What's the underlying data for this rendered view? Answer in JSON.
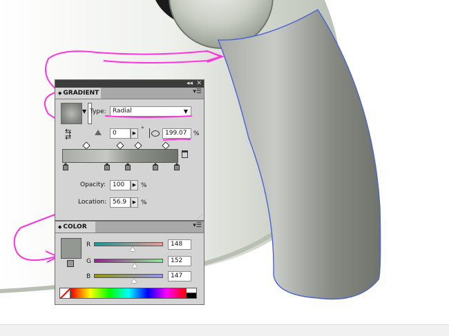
{
  "gradient_panel": {
    "tab_label": "GRADIENT",
    "type_label": "Type:",
    "type_value": "Radial",
    "angle_value": "0",
    "degree_symbol": "°",
    "aspect_value": "199.07",
    "aspect_unit": "%",
    "opacity_label": "Opacity:",
    "opacity_value": "100",
    "opacity_unit": "%",
    "location_label": "Location:",
    "location_value": "56.9",
    "location_unit": "%"
  },
  "color_panel": {
    "tab_label": "COLOR",
    "r_label": "R",
    "g_label": "G",
    "b_label": "B",
    "r_value": "148",
    "g_value": "152",
    "b_value": "147",
    "fill_color": "#949893"
  },
  "titlebar": {
    "collapse_glyph": "◂◂",
    "close_glyph": "✕"
  },
  "colors": {
    "annotation": "#ff33dd",
    "selection": "#4a62d6",
    "panel_bg": "#d4d4d4"
  }
}
